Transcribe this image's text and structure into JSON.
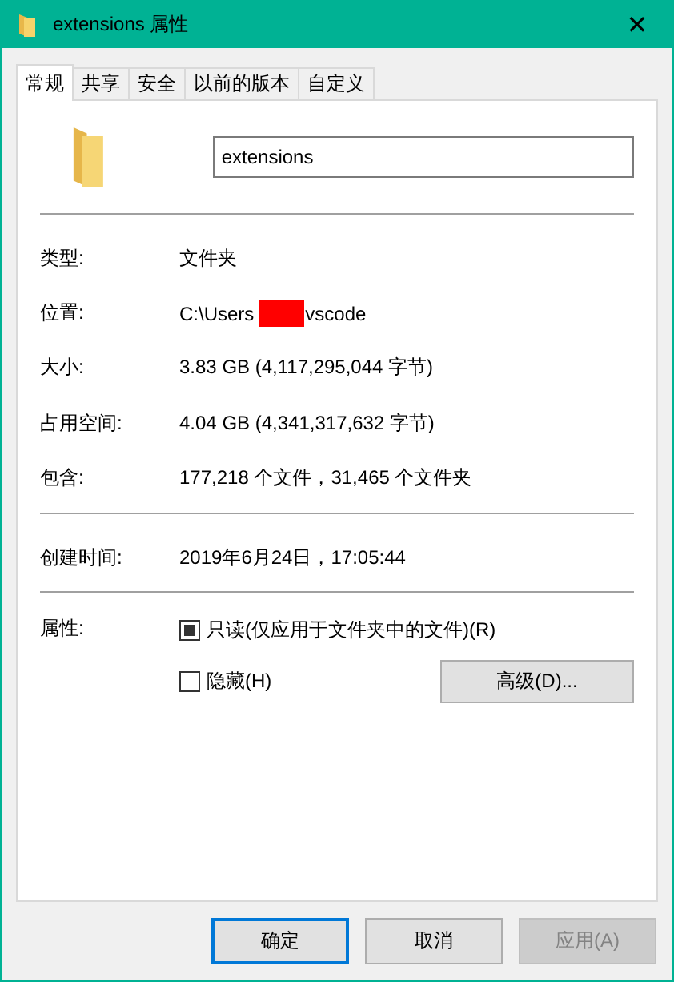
{
  "window": {
    "title": "extensions 属性",
    "close": "✕"
  },
  "tabs": [
    {
      "label": "常规",
      "selected": true
    },
    {
      "label": "共享",
      "selected": false
    },
    {
      "label": "安全",
      "selected": false
    },
    {
      "label": "以前的版本",
      "selected": false
    },
    {
      "label": "自定义",
      "selected": false
    }
  ],
  "name_field": {
    "value": "extensions"
  },
  "groups": [
    {
      "rows": [
        {
          "label": "类型:",
          "value": "文件夹"
        },
        {
          "label": "位置:",
          "value": "C:\\Users",
          "value_after": "vscode",
          "redacted": true
        },
        {
          "label": "大小:",
          "value": "3.83 GB (4,117,295,044 字节)"
        },
        {
          "label": "占用空间:",
          "value": "4.04 GB (4,341,317,632 字节)"
        },
        {
          "label": "包含:",
          "value": "177,218 个文件，31,465 个文件夹"
        }
      ]
    },
    {
      "rows": [
        {
          "label": "创建时间:",
          "value": "2019年6月24日，17:05:44"
        }
      ]
    }
  ],
  "attributes": {
    "label": "属性:",
    "options": [
      {
        "label": "只读(仅应用于文件夹中的文件)(R)",
        "checked": false,
        "indeterminate": true
      },
      {
        "label": "隐藏(H)",
        "checked": false,
        "indeterminate": false
      }
    ],
    "advanced_button": "高级(D)..."
  },
  "buttons": [
    {
      "label": "确定",
      "default": true,
      "disabled": false
    },
    {
      "label": "取消",
      "default": false,
      "disabled": false
    },
    {
      "label": "应用(A)",
      "default": false,
      "disabled": true
    }
  ]
}
